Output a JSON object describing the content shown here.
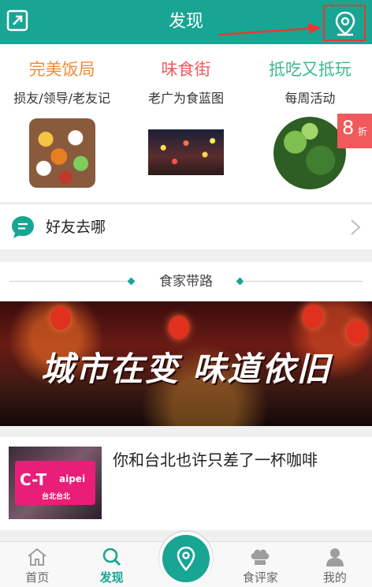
{
  "header": {
    "title": "发现",
    "share_icon": "share-icon",
    "location_icon": "location-pin-icon"
  },
  "categories": [
    {
      "title": "完美饭局",
      "subtitle": "损友/领导/老友记",
      "color": "#f08a3c"
    },
    {
      "title": "味食街",
      "subtitle": "老广为食蓝图",
      "color": "#f05a5a"
    },
    {
      "title": "抵吃又抵玩",
      "subtitle": "每周活动",
      "color": "#3db88f"
    }
  ],
  "badge": {
    "number": "8",
    "unit": "折"
  },
  "friends": {
    "label": "好友去哪",
    "icon": "chat-bubble-icon"
  },
  "section": {
    "title": "食家带路"
  },
  "banner": {
    "text": "城市在变 味道依旧"
  },
  "article": {
    "title": "你和台北也许只差了一杯咖啡",
    "thumb_sign_left": "C-T",
    "thumb_sign_right": "aipei",
    "thumb_sign_small": "台北台北"
  },
  "nav": {
    "items": [
      {
        "label": "首页",
        "icon": "home-icon"
      },
      {
        "label": "发现",
        "icon": "search-icon"
      },
      {
        "label": "",
        "icon": "location-pin-icon"
      },
      {
        "label": "食评家",
        "icon": "chef-hat-icon"
      },
      {
        "label": "我的",
        "icon": "user-icon"
      }
    ]
  },
  "colors": {
    "brand": "#18a594",
    "highlight": "#e53935"
  }
}
